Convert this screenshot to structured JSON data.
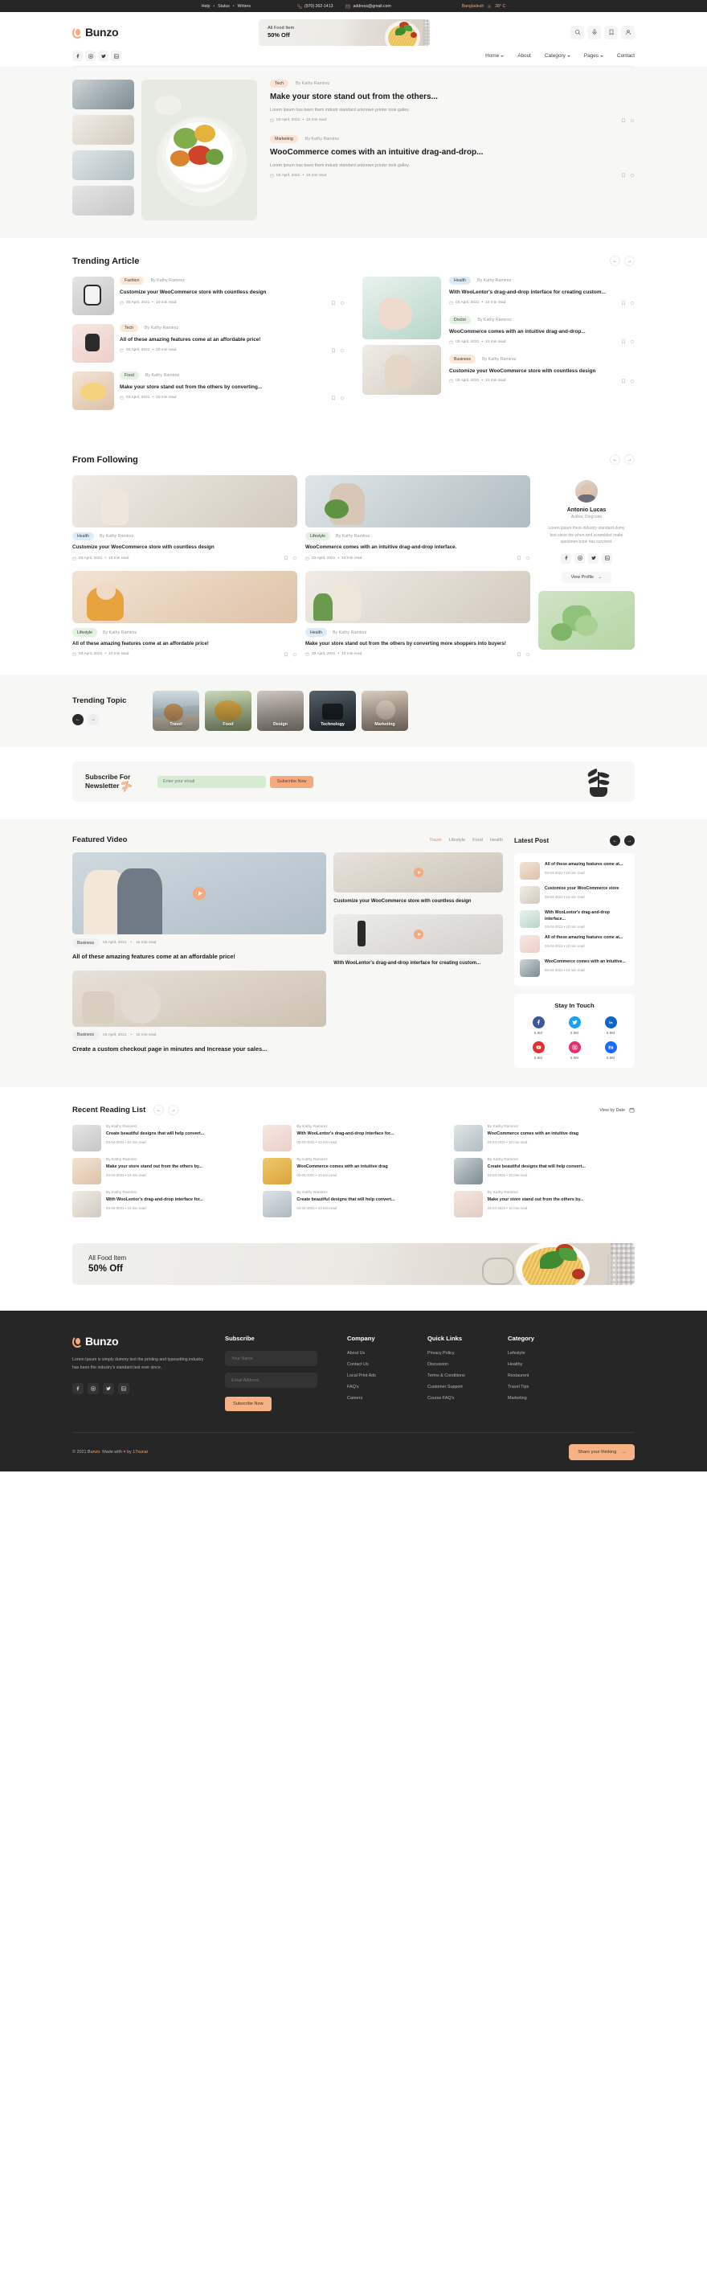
{
  "topbar": {
    "links": [
      "Help",
      "Status",
      "Writers"
    ],
    "phone": "(970) 262-1413",
    "email": "address@gmail.com",
    "location": "Bangladesh",
    "temperature": "28° C"
  },
  "header": {
    "brand": "Bunzo",
    "promo": {
      "line1": "All Food Item",
      "line2": "50% Off"
    },
    "icons": [
      "search-icon",
      "mic-icon",
      "bookmark-icon",
      "user-icon"
    ],
    "social": [
      "facebook",
      "instagram",
      "twitter",
      "linkedin"
    ],
    "menu": [
      {
        "label": "Home",
        "caret": true
      },
      {
        "label": "About",
        "caret": false
      },
      {
        "label": "Category",
        "caret": true
      },
      {
        "label": "Pages",
        "caret": true
      },
      {
        "label": "Contact",
        "caret": false
      }
    ]
  },
  "hero": {
    "cards": [
      {
        "tag": "Tech",
        "by": "By Kathy Ramirez",
        "title": "Make your store stand out from the others...",
        "excerpt": "Lorem Ipsum has been them industr standard unknown printer took galley.",
        "date": "03 April, 2021",
        "read": "10 min read"
      },
      {
        "tag": "Marketing",
        "by": "By Kathy Ramirez",
        "title": "WooCommerce comes with an intuitive drag-and-drop...",
        "excerpt": "Lorem Ipsum has been them industr standard unknown printer took galley.",
        "date": "03 April, 2021",
        "read": "10 min read"
      }
    ]
  },
  "trending": {
    "title": "Trending Article",
    "left": [
      {
        "tag": "Fashion",
        "tagColor": "cream",
        "by": "By Kathy Ramirez",
        "title": "Customize your WooCommerce store with countless design",
        "date": "03 April, 2021",
        "read": "10 min read"
      },
      {
        "tag": "Tech",
        "tagColor": "cream",
        "by": "By Kathy Ramirez",
        "title": "All of these amazing features come at an affordable price!",
        "date": "03 April, 2021",
        "read": "10 min read"
      },
      {
        "tag": "Food",
        "tagColor": "lightgreen",
        "by": "By Kathy Ramirez",
        "title": "Make your store stand out from the others by converting...",
        "date": "03 April, 2021",
        "read": "10 min read"
      }
    ],
    "right": [
      {
        "tag": "Health",
        "tagColor": "blue",
        "by": "By Kathy Ramirez",
        "title": "With WooLentor's drag-and-drop interface for creating custom...",
        "date": "03 April, 2021",
        "read": "10 min read"
      },
      {
        "tag": "Doctor",
        "tagColor": "lightgreen",
        "by": "By Kathy Ramirez",
        "title": "WooCommerce comes with an intuitive drag-and-drop...",
        "date": "03 April, 2021",
        "read": "10 min read"
      },
      {
        "tag": "Business",
        "tagColor": "cream",
        "by": "By Kathy Ramirez",
        "title": "Customize your WooCommerce store with countless design",
        "date": "03 April, 2021",
        "read": "10 min read"
      }
    ]
  },
  "following": {
    "title": "From Following",
    "cards": [
      {
        "tag": "Health",
        "tagColor": "blue",
        "by": "By Kathy Ramirez",
        "title": "Customize your WooCommerce store with countless design",
        "date": "03 April, 2021",
        "read": "10 min read"
      },
      {
        "tag": "Lifestyle",
        "tagColor": "lightgreen",
        "by": "By Kathy Ramirez",
        "title": "WooCommerce comes with an intuitive drag-and-drop interface.",
        "date": "03 April, 2021",
        "read": "10 min read"
      },
      {
        "tag": "Lifestyle",
        "tagColor": "lightgreen",
        "by": "By Kathy Ramirez",
        "title": "All of these amazing features come at an affordable price!",
        "date": "03 April, 2021",
        "read": "10 min read"
      },
      {
        "tag": "Health",
        "tagColor": "blue",
        "by": "By Kathy Ramirez",
        "title": "Make your store stand out from the others by converting more shoppers into buyers!",
        "date": "03 April, 2021",
        "read": "10 min read"
      }
    ],
    "profile": {
      "name": "Antonio Lucas",
      "role": "Author, Dingcode",
      "desc": "Lorem ipsum there industry standard dumy text since the when and scrambled make specimen book has survived.",
      "button": "View Profile",
      "social": [
        "facebook",
        "instagram",
        "twitter",
        "linkedin"
      ]
    }
  },
  "topics": {
    "title": "Trending Topic",
    "items": [
      "Travel",
      "Food",
      "Design",
      "Technology",
      "Marketing"
    ]
  },
  "newsletter": {
    "title": "Subscribe For Newsletter",
    "placeholder": "Enter your email",
    "button": "Subscribe Now"
  },
  "featured": {
    "title": "Featured Video",
    "tabs": [
      "Travel",
      "Lifestyle",
      "Food",
      "Health"
    ],
    "activeTab": "Travel",
    "main": [
      {
        "tag": "Business",
        "title": "All of these amazing features come at an affordable price!",
        "date": "03 April, 2021",
        "read": "10 min read"
      },
      {
        "tag": "Business",
        "title": "Create a custom checkout page in minutes and Increase your sales...",
        "date": "03 April, 2021",
        "read": "10 min read"
      }
    ],
    "side": [
      {
        "title": "Customize your WooCommerce store with countless design",
        "date": "03 April, 2021",
        "read": "10 min read"
      },
      {
        "title": "With WooLentor's drag-and-drop interface for creating custom...",
        "date": "03 April, 2021",
        "read": "10 min read"
      }
    ]
  },
  "latest": {
    "title": "Latest Post",
    "items": [
      {
        "title": "All of these amazing features come at...",
        "meta": "03-04-2021 • 10 min read"
      },
      {
        "title": "Customize your WooCommerce store",
        "meta": "03-04-2021 • 10 min read"
      },
      {
        "title": "With WooLentor's drag-and-drop interface...",
        "meta": "03-04-2021 • 10 min read"
      },
      {
        "title": "All of these amazing features come at...",
        "meta": "03-04-2021 • 10 min read"
      },
      {
        "title": "WooCommerce comes with an intuitive...",
        "meta": "03-04-2021 • 10 min read"
      }
    ]
  },
  "stay": {
    "title": "Stay In Touch",
    "items": [
      {
        "network": "facebook",
        "count": "5.6M",
        "color": "#3b5998"
      },
      {
        "network": "twitter",
        "count": "6.9M",
        "color": "#1da1f2"
      },
      {
        "network": "linkedin",
        "count": "6.9M",
        "color": "#0a66c2"
      },
      {
        "network": "youtube",
        "count": "5.6M",
        "color": "#e02f2f"
      },
      {
        "network": "instagram",
        "count": "6.9M",
        "color": "#e1306c"
      },
      {
        "network": "behance",
        "count": "6.9M",
        "color": "#1769ff"
      }
    ]
  },
  "recent": {
    "title": "Recent Reading List",
    "viewAll": "View by Date",
    "items": [
      {
        "by": "By Kathy Ramirez",
        "title": "Create beautiful designs that will help convert...",
        "meta": "03-04-2021 • 10 min read"
      },
      {
        "by": "By Kathy Ramirez",
        "title": "With WooLentor's drag-and-drop interface for...",
        "meta": "03-04-2021 • 10 min read"
      },
      {
        "by": "By Kathy Ramirez",
        "title": "WooCommerce comes with an intuitive drag",
        "meta": "03-04-2021 • 10 min read"
      },
      {
        "by": "By Kathy Ramirez",
        "title": "Make your store stand out from the others by...",
        "meta": "03-04-2021 • 10 min read"
      },
      {
        "by": "By Kathy Ramirez",
        "title": "WooCommerce comes with an intuitive drag",
        "meta": "03-04-2021 • 10 min read"
      },
      {
        "by": "By Kathy Ramirez",
        "title": "Create beautiful designs that will help convert...",
        "meta": "03-04-2021 • 10 min read"
      },
      {
        "by": "By Kathy Ramirez",
        "title": "With WooLentor's drag-and-drop interface for...",
        "meta": "03-04-2021 • 10 min read"
      },
      {
        "by": "By Kathy Ramirez",
        "title": "Create beautiful designs that will help convert...",
        "meta": "03-04-2021 • 10 min read"
      },
      {
        "by": "By Kathy Ramirez",
        "title": "Make your store stand out from the others by...",
        "meta": "03-04-2021 • 10 min read"
      }
    ]
  },
  "banner": {
    "line1": "All Food Item",
    "line2": "50% Off"
  },
  "footer": {
    "brand": "Bunzo",
    "desc": "Lorem Ipsum is simply dummy text the printing and typesetting industry has been the industry's standard text ever since.",
    "social": [
      "facebook",
      "instagram",
      "twitter",
      "linkedin"
    ],
    "subscribe": {
      "heading": "Subscribe",
      "namePlaceholder": "Your Name",
      "emailPlaceholder": "Email Address",
      "button": "Subscribe Now"
    },
    "columns": [
      {
        "heading": "Company",
        "links": [
          "About Us",
          "Contact Us",
          "Local Print Ads",
          "FAQ's",
          "Careers"
        ]
      },
      {
        "heading": "Quick Links",
        "links": [
          "Privacy Policy",
          "Discussion",
          "Terms & Conditions",
          "Customer Support",
          "Course FAQ's"
        ]
      },
      {
        "heading": "Category",
        "links": [
          "Lefestyle",
          "Healthy",
          "Restaurent",
          "Travel Tips",
          "Marketing"
        ]
      }
    ],
    "copyright_pre": "© 2021 ",
    "copyright_brand": "Bunzo",
    "copyright_mid": ". Made with ",
    "copyright_by": " by ",
    "copyright_author": "17sucai",
    "share": "Share your thinking"
  }
}
